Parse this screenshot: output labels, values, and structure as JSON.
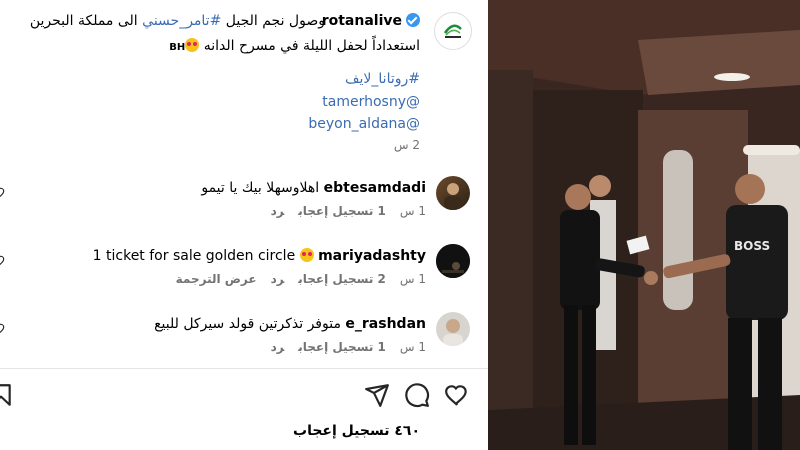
{
  "post": {
    "username": "rotanalive",
    "caption_line1_pre": "وصول نجم الجيل ",
    "caption_hashtag": "#تامر_حسني",
    "caption_line1_post": " الى مملكة البحرين",
    "caption_line2": "استعداداً لحفل الليلة في مسرح الدانه",
    "caption_flag": "BH",
    "hashtag2": "#روتانا_لايف",
    "mention1": "tamerhosny@",
    "mention2": "beyon_aldana@",
    "time": "2 س"
  },
  "comments": [
    {
      "username": "ebtesamdadi",
      "text": "اهلاوسهلا بيك يا تيمو",
      "time": "1 س",
      "likes": "1 تسجيل إعجاب",
      "reply": "رد",
      "translate": ""
    },
    {
      "username": "mariyadashty",
      "text": "1 ticket for sale golden circle",
      "time": "1 س",
      "likes": "2 تسجيل إعجاب",
      "reply": "رد",
      "translate": "عرض الترجمة"
    },
    {
      "username": "e_rashdan",
      "text": "متوفر تذكرتين قولد سيركل للبيع",
      "time": "1 س",
      "likes": "1 تسجيل إعجاب",
      "reply": "رد",
      "translate": ""
    }
  ],
  "footer": {
    "likes_count": "٤٦٠ تسجيل إعجاب",
    "sub": "..."
  },
  "icons": {
    "like": "heart-icon",
    "comment": "comment-icon",
    "share": "share-icon",
    "save": "bookmark-icon"
  },
  "colors": {
    "link": "#3b6bb3",
    "verified": "#3897f0",
    "muted": "#737373"
  }
}
